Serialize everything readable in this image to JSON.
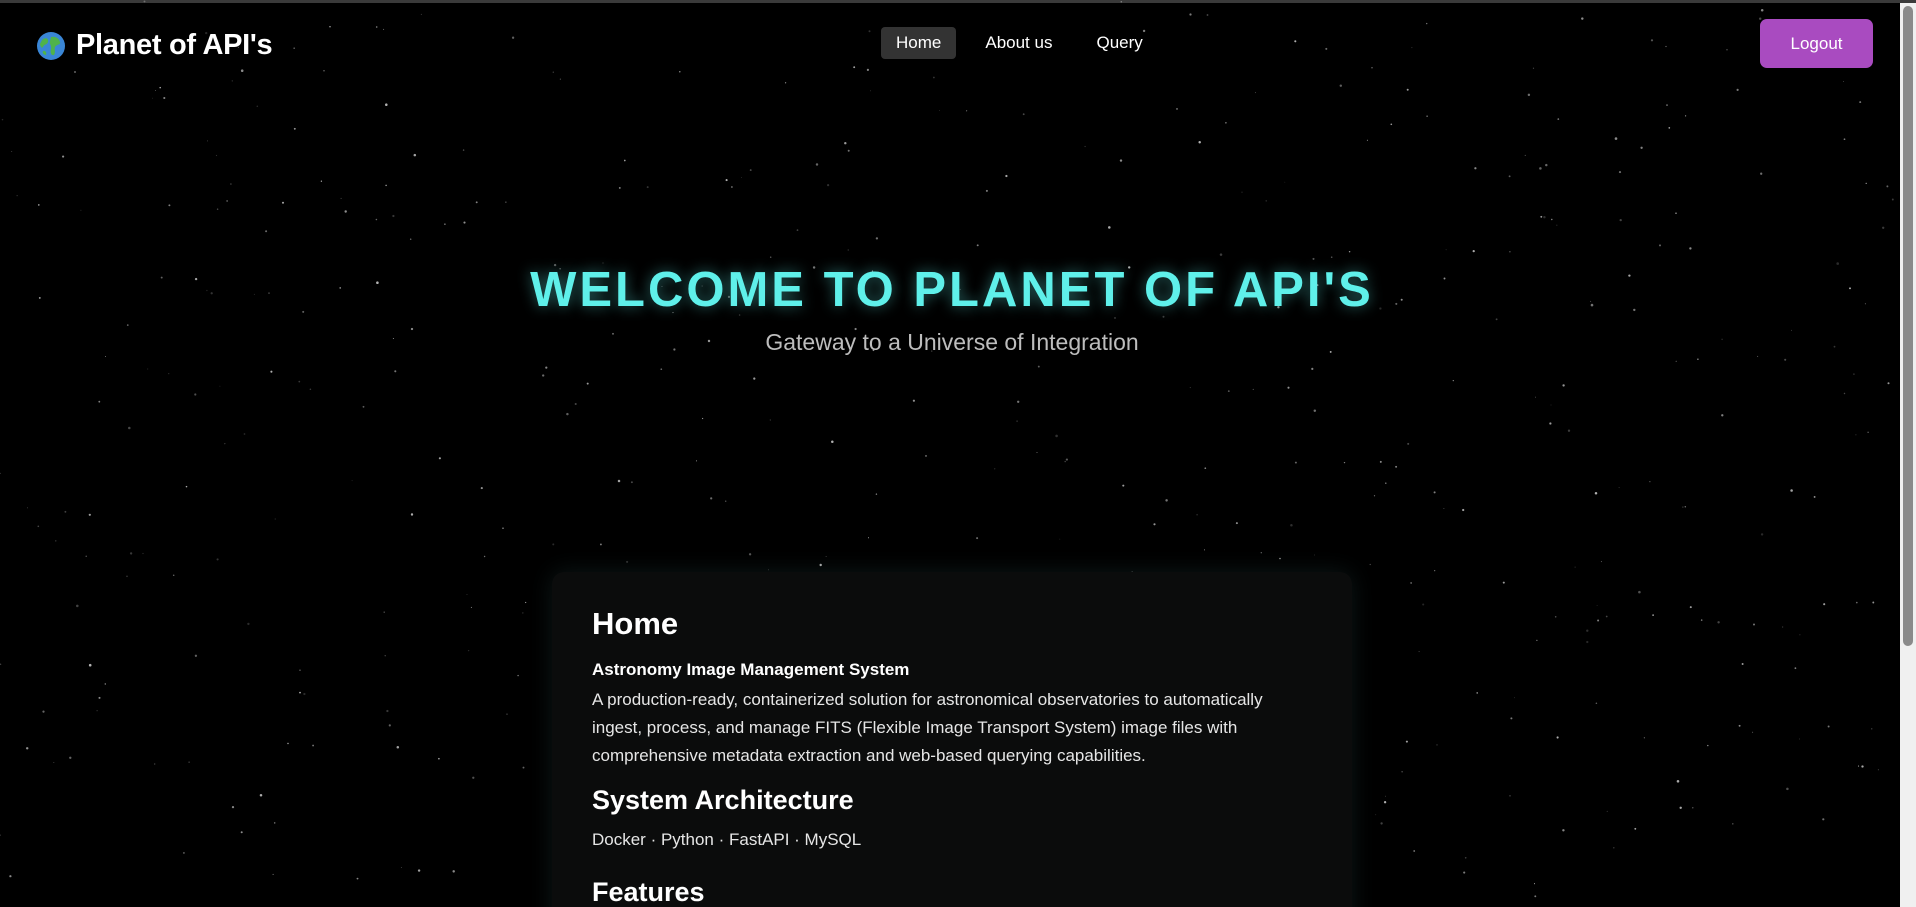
{
  "app": {
    "brand_name": "Planet of API's",
    "brand_icon": "globe-icon"
  },
  "nav": {
    "links": [
      {
        "label": "Home",
        "active": true
      },
      {
        "label": "About us",
        "active": false
      },
      {
        "label": "Query",
        "active": false
      }
    ],
    "logout_label": "Logout"
  },
  "hero": {
    "title": "WELCOME TO PLANET OF API'S",
    "subtitle": "Gateway to a Universe of Integration"
  },
  "card": {
    "heading": "Home",
    "subheading": "Astronomy Image Management System",
    "paragraph": "A production-ready, containerized solution for astronomical observatories to automatically ingest, process, and manage FITS (Flexible Image Transport System) image files with comprehensive metadata extraction and web-based querying capabilities.",
    "architecture_heading": "System Architecture",
    "tech_stack": "Docker · Python · FastAPI · MySQL",
    "features_heading": "Features"
  },
  "colors": {
    "accent": "#5ff0ea",
    "logout_button": "#a94bc0",
    "background": "#000000",
    "active_nav": "#333333"
  }
}
